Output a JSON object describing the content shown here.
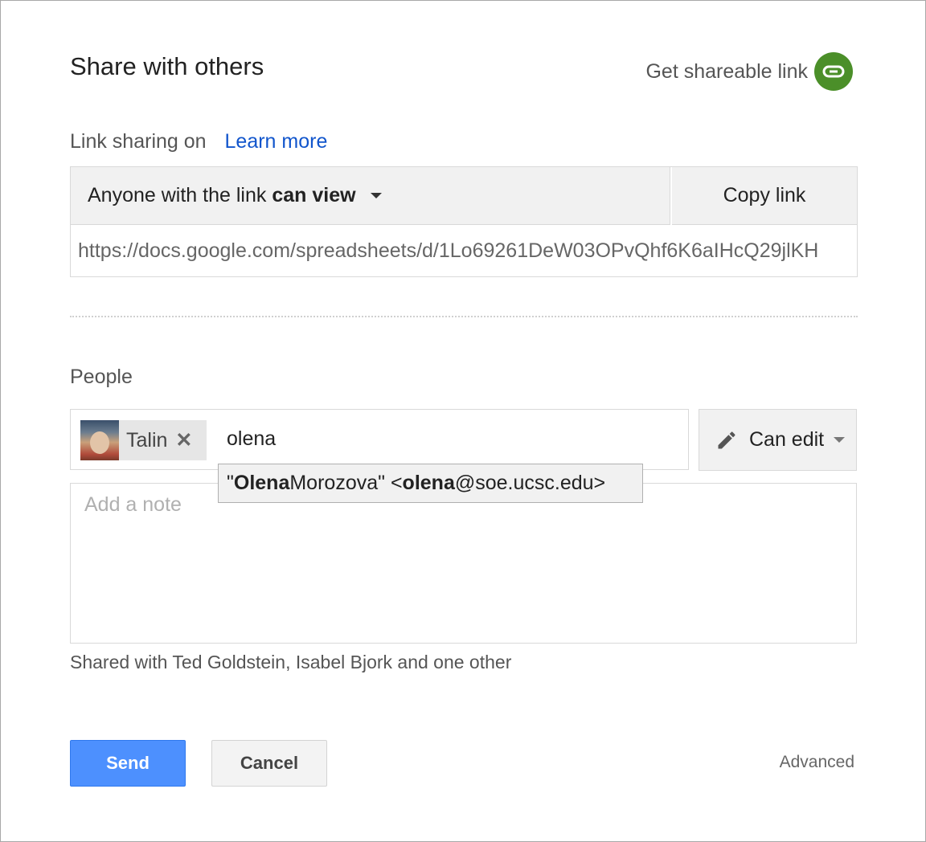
{
  "dialog": {
    "title": "Share with others",
    "get_link_label": "Get shareable link",
    "get_link_icon": "link-icon",
    "accent_green": "#4b8f29"
  },
  "link_sharing": {
    "status_label": "Link sharing on",
    "learn_more": "Learn more",
    "access_prefix": "Anyone with the link",
    "access_level": "can view",
    "copy_link": "Copy link",
    "url": "https://docs.google.com/spreadsheets/d/1Lo69261DeW03OPvQhf6K6aIHcQ29jlKH"
  },
  "people": {
    "label": "People",
    "chips": [
      {
        "name": "Talin",
        "remove_icon": "close-icon"
      }
    ],
    "input_value": "olena",
    "permission": "Can edit",
    "permission_icon": "pencil-icon",
    "suggestion": {
      "q_open": "\"",
      "name_match": "Olena",
      "name_rest": " Morozova\" <",
      "email_match": "olena",
      "email_rest": "@soe.ucsc.edu>"
    },
    "note_placeholder": "Add a note",
    "shared_with": "Shared with Ted Goldstein, Isabel Bjork and one other"
  },
  "footer": {
    "send": "Send",
    "cancel": "Cancel",
    "advanced": "Advanced",
    "send_color": "#4d90fe"
  }
}
